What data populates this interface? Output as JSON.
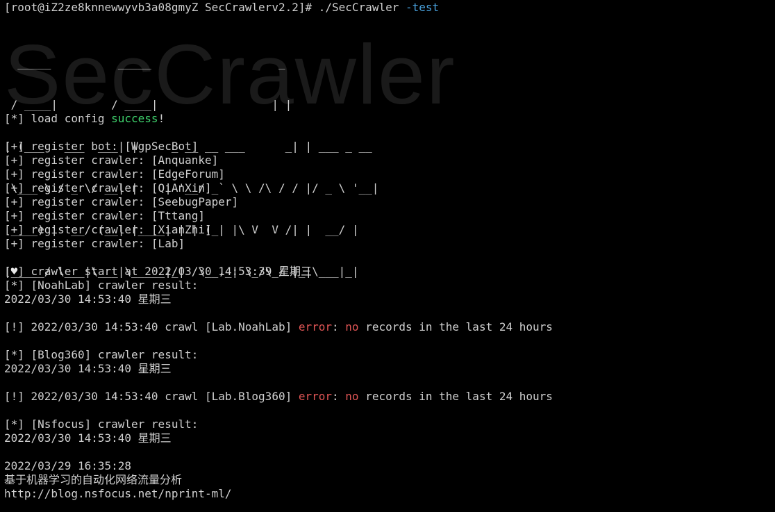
{
  "prompt": {
    "host_part": "[root@iZ2ze8knnewwyvb3a08gmyZ SecCrawlerv2.2]# ",
    "command": "./SecCrawler ",
    "flag": "-test"
  },
  "banner": {
    "ascii_lines": [
      "  _____          _____                   _",
      " / ____|        / ____|                 | |",
      "| (___   ___  ___| |     _ __ __ ___      _| | ___ _ __",
      " \\___ \\ / _ \\/ __| |    | '__/ _` \\ \\ /\\ / / |/ _ \\ '__|",
      " ____) |  __/ (__| |____| | | (_| |\\ V  V /| |  __/ |",
      "|_____/ \\___|\\___|\\_____|_|  \\__,_| \\_/\\_/ |_|\\___|_|"
    ],
    "watermark": "SecCrawler"
  },
  "config": {
    "prefix": "[*] load config ",
    "status": "success",
    "suffix": "!"
  },
  "registrations": [
    "[+] register bot: [WgpSecBot]",
    "[+] register crawler: [Anquanke]",
    "[+] register crawler: [EdgeForum]",
    "[+] register crawler: [QiAnXin]",
    "[+] register crawler: [SeebugPaper]",
    "[+] register crawler: [Tttang]",
    "[+] register crawler: [XianZhi]",
    "[+] register crawler: [Lab]"
  ],
  "start": {
    "prefix": "[",
    "heart": "♥",
    "rest": "] crawler start at 2022/03/30 14:53:39 星期三"
  },
  "results": [
    {
      "header": "[*] [NoahLab] crawler result:",
      "time": "2022/03/30 14:53:40 星期三",
      "err_prefix": "[!] 2022/03/30 14:53:40 crawl [Lab.NoahLab] ",
      "err_word": "error",
      "err_colon": ": ",
      "err_no": "no",
      "err_rest": " records in the last 24 hours"
    },
    {
      "header": "[*] [Blog360] crawler result:",
      "time": "2022/03/30 14:53:40 星期三",
      "err_prefix": "[!] 2022/03/30 14:53:40 crawl [Lab.Blog360] ",
      "err_word": "error",
      "err_colon": ": ",
      "err_no": "no",
      "err_rest": " records in the last 24 hours"
    }
  ],
  "nsfocus": {
    "header": "[*] [Nsfocus] crawler result:",
    "time": "2022/03/30 14:53:40 星期三",
    "item_date": "2022/03/29 16:35:28",
    "item_title": "基于机器学习的自动化网络流量分析",
    "item_url": "http://blog.nsfocus.net/nprint-ml/"
  },
  "colors": {
    "background": "#000000",
    "text": "#d0d0d0",
    "success": "#3fd36d",
    "error": "#e05555",
    "flag": "#4aa3df"
  }
}
